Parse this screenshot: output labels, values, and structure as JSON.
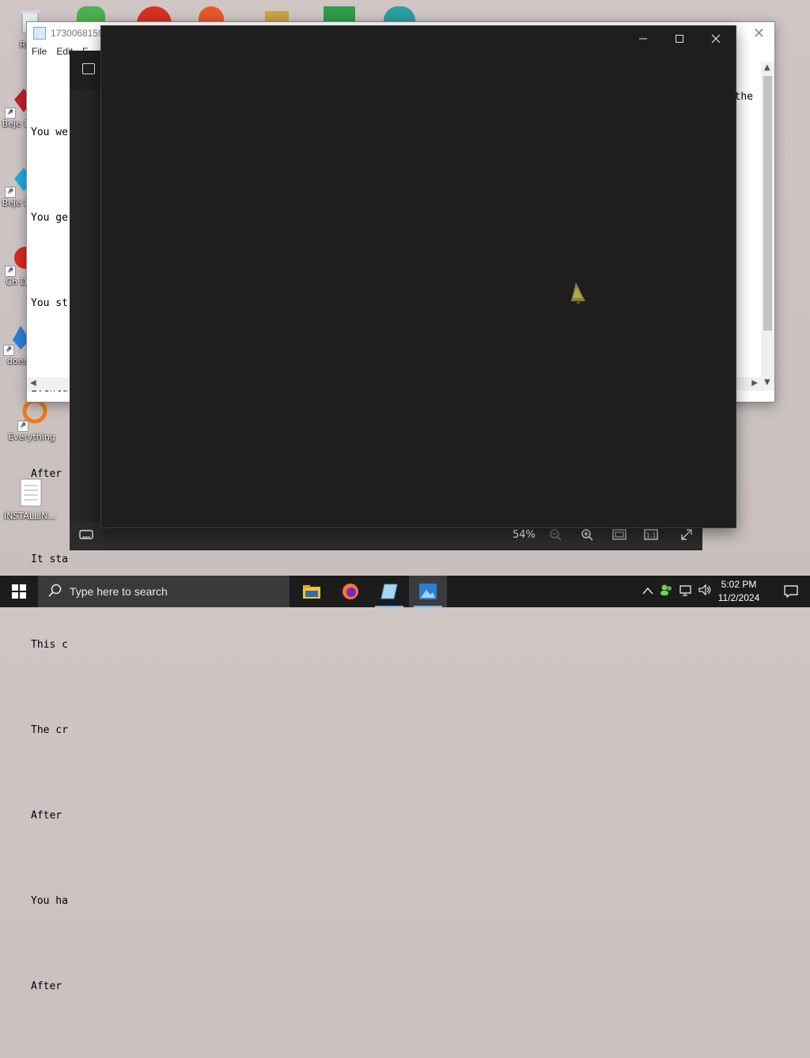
{
  "desktop": {
    "icons": [
      {
        "label": "Recy"
      },
      {
        "label": "Beje De"
      },
      {
        "label": "Beje De"
      },
      {
        "label": "Ch De"
      },
      {
        "label": "does"
      },
      {
        "label": "Everything"
      },
      {
        "label": "INSTALLIN..."
      }
    ]
  },
  "notepad": {
    "title": "1730068159,",
    "menu": [
      "File",
      "Edit",
      "F"
    ],
    "lines": [
      "You we",
      "You ge",
      "You st",
      "Eventu",
      "After",
      "It sta",
      "This c",
      "The cr",
      "After",
      "You ha",
      "After"
    ],
    "trailing_word": "the"
  },
  "viewer": {
    "zoom": "54%"
  },
  "taskbar": {
    "search_placeholder": "Type here to search",
    "time": "5:02 PM",
    "date": "11/2/2024"
  },
  "colors": {
    "taskbar": "#1c1c1c",
    "viewer_bg": "#1e1e1e",
    "accent": "#76b9ed"
  }
}
